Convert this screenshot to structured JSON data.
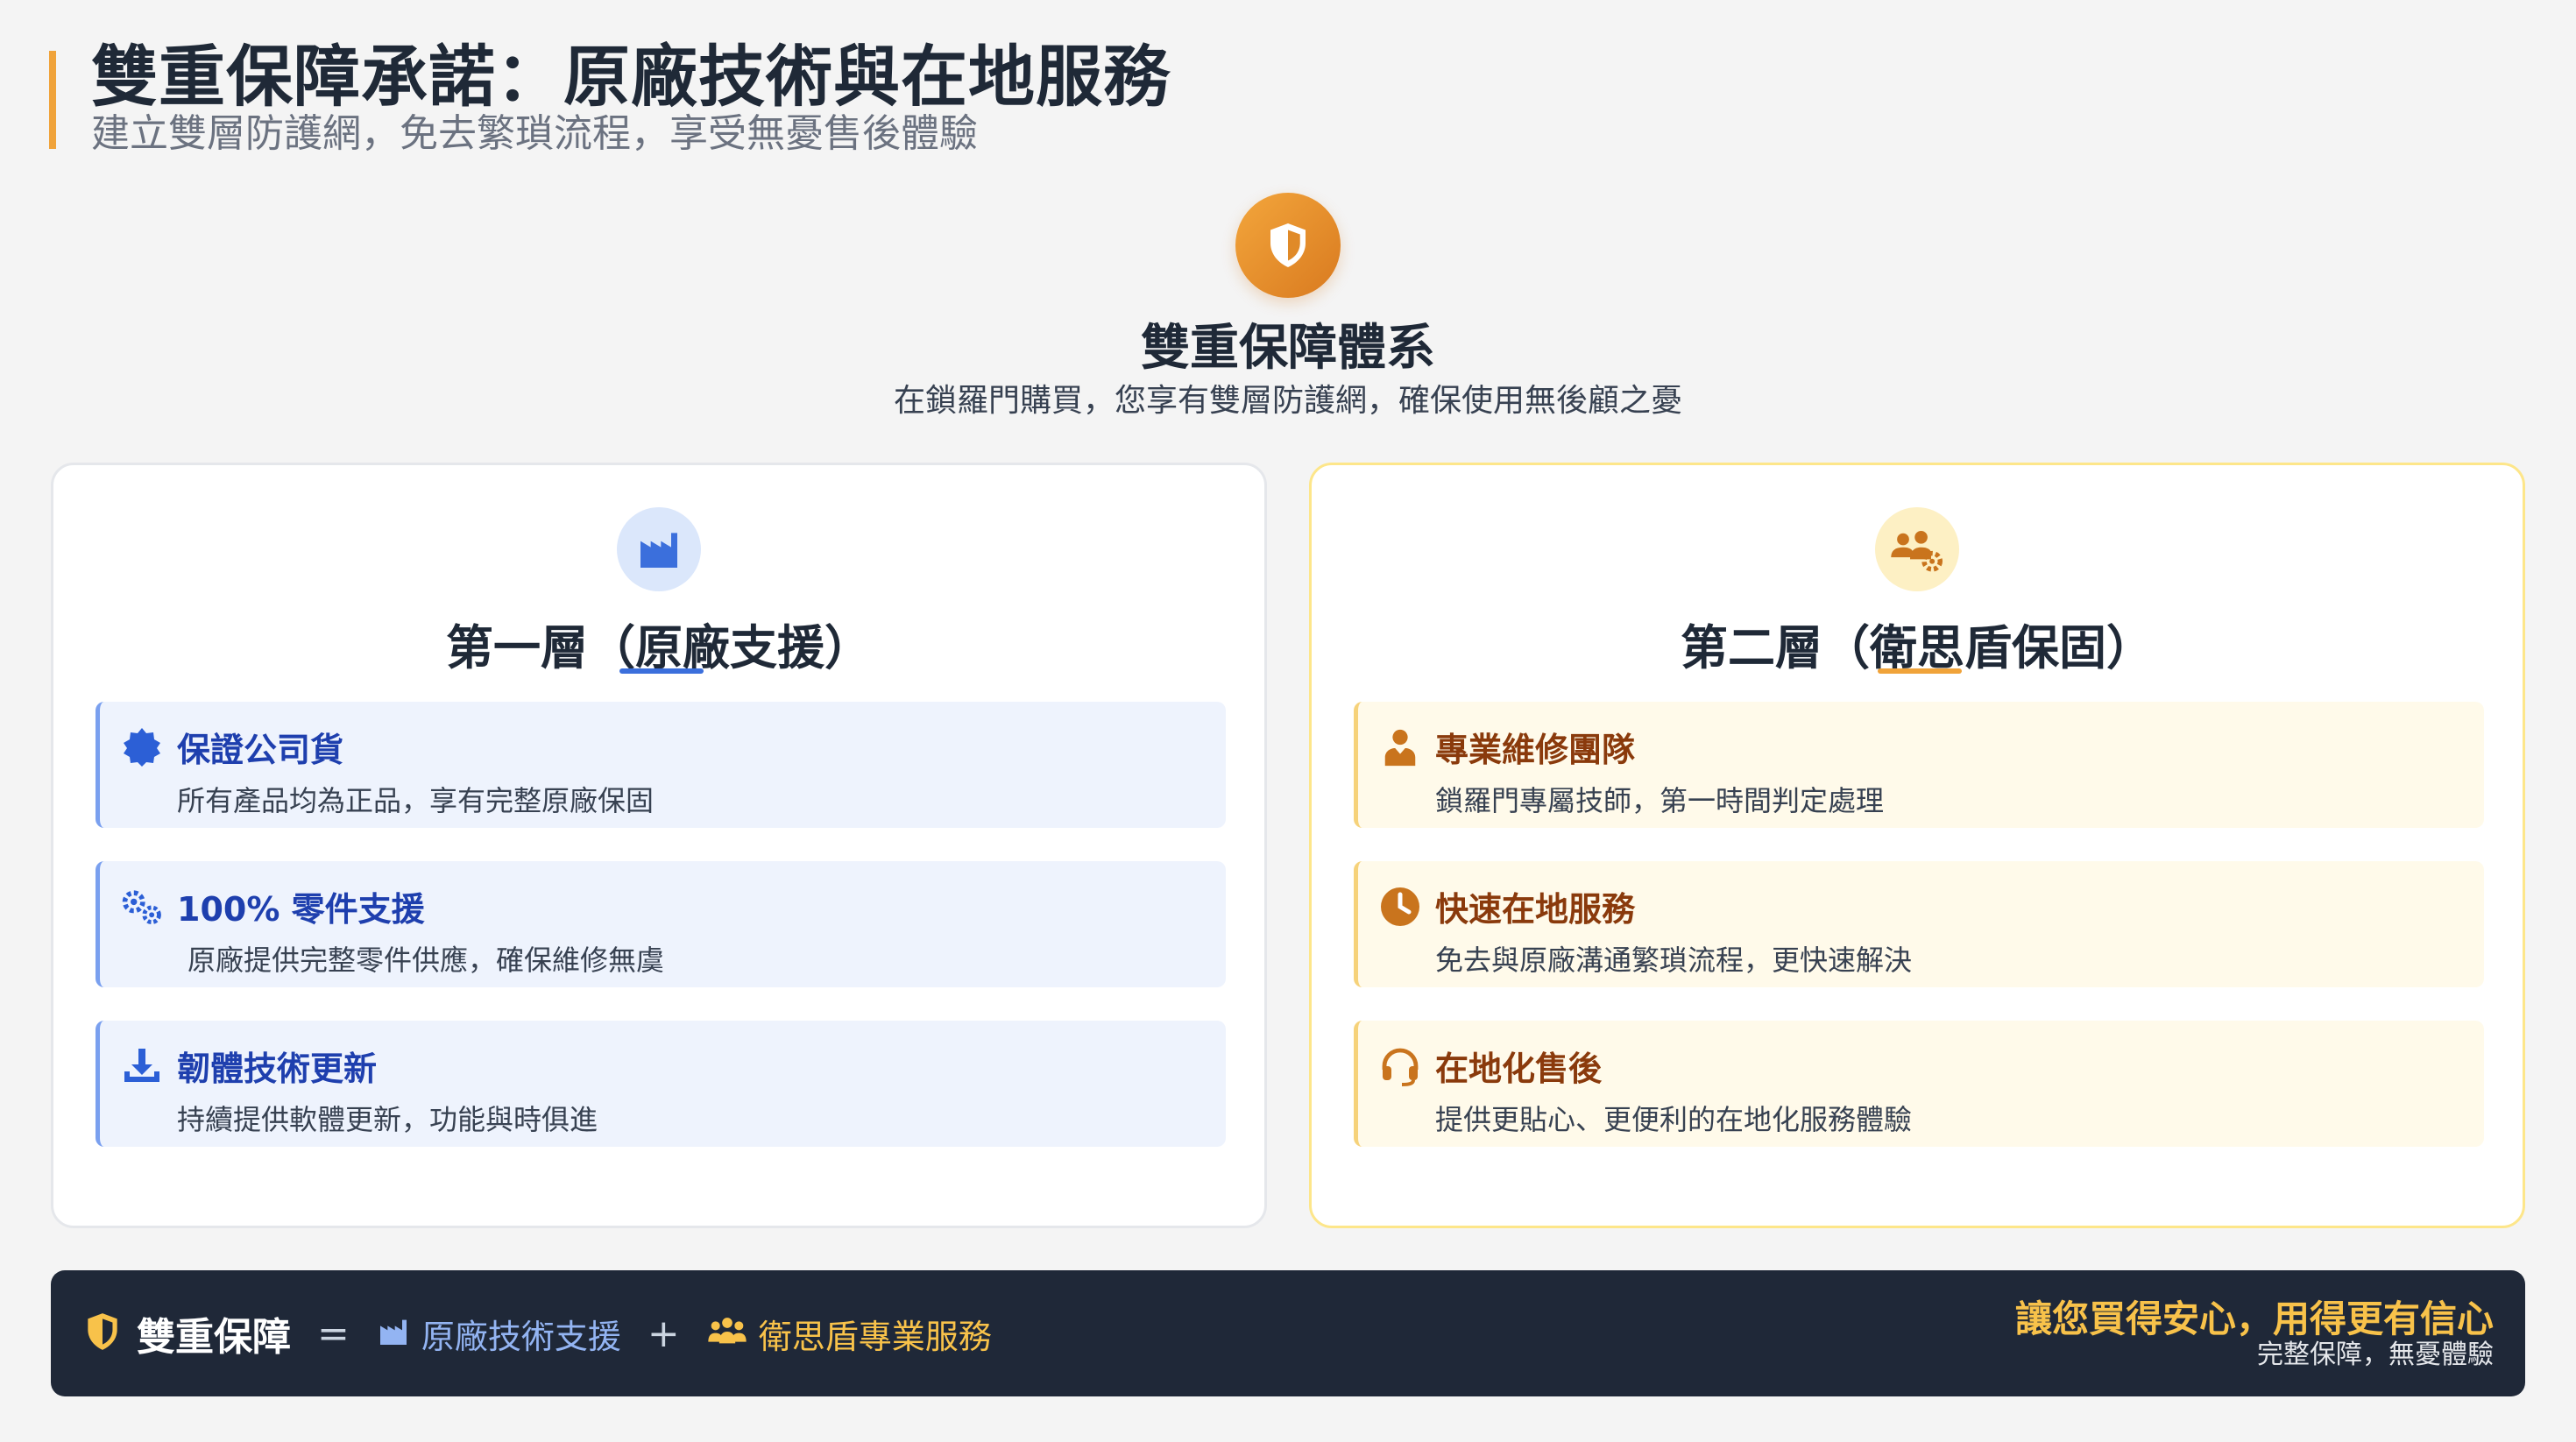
{
  "header": {
    "title": "雙重保障承諾：原廠技術與在地服務",
    "subtitle": "建立雙層防護網，免去繁瑣流程，享受無憂售後體驗"
  },
  "center": {
    "icon": "shield-icon",
    "title": "雙重保障體系",
    "description": "在鎖羅門購買，您享有雙層防護網，確保使用無後顧之憂"
  },
  "left_card": {
    "icon": "factory-icon",
    "title": "第一層（原廠支援）",
    "items": [
      {
        "icon": "badge-check-icon",
        "title": "保證公司貨",
        "description": "所有產品均為正品，享有完整原廠保固"
      },
      {
        "icon": "gears-icon",
        "title": "100% 零件支援",
        "description": "原廠提供完整零件供應，確保維修無虞"
      },
      {
        "icon": "download-icon",
        "title": "韌體技術更新",
        "description": "持續提供軟體更新，功能與時俱進"
      }
    ]
  },
  "right_card": {
    "icon": "users-gear-icon",
    "title": "第二層（衛思盾保固）",
    "items": [
      {
        "icon": "technician-icon",
        "title": "專業維修團隊",
        "description": "鎖羅門專屬技師，第一時間判定處理"
      },
      {
        "icon": "clock-icon",
        "title": "快速在地服務",
        "description": "免去與原廠溝通繁瑣流程，更快速解決"
      },
      {
        "icon": "headset-icon",
        "title": "在地化售後",
        "description": "提供更貼心、更便利的在地化服務體驗"
      }
    ]
  },
  "footer": {
    "brand": "雙重保障",
    "equals": "=",
    "plus": "+",
    "tech": "原廠技術支援",
    "local": "衛思盾專業服務",
    "slogan": "讓您買得安心，用得更有信心",
    "sub": "完整保障，無憂體驗"
  },
  "colors": {
    "accent_orange": "#f0a33a",
    "blue": "#3b6fdc",
    "dark_footer": "#1f2838",
    "gold": "#f8c24a"
  }
}
